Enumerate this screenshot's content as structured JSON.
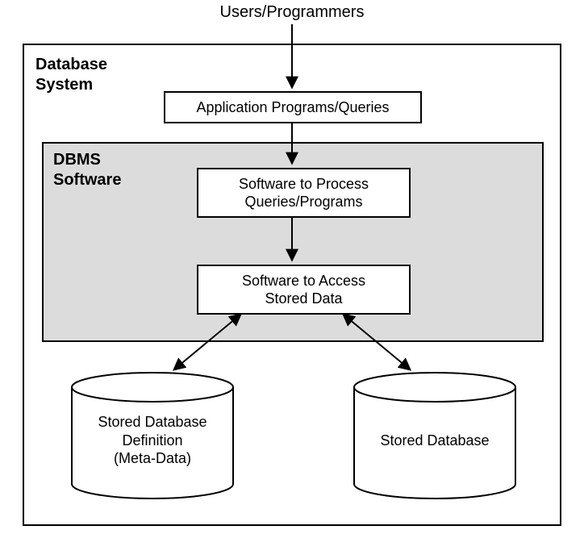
{
  "top_label": "Users/Programmers",
  "db_system_label": "Database\nSystem",
  "dbms_label": "DBMS\nSoftware",
  "nodes": {
    "app": "Application Programs/Queries",
    "proc": "Software to Process\nQueries/Programs",
    "access": "Software to Access\nStored Data"
  },
  "cylinders": {
    "meta": "Stored Database\nDefinition\n(Meta-Data)",
    "db": "Stored Database"
  }
}
